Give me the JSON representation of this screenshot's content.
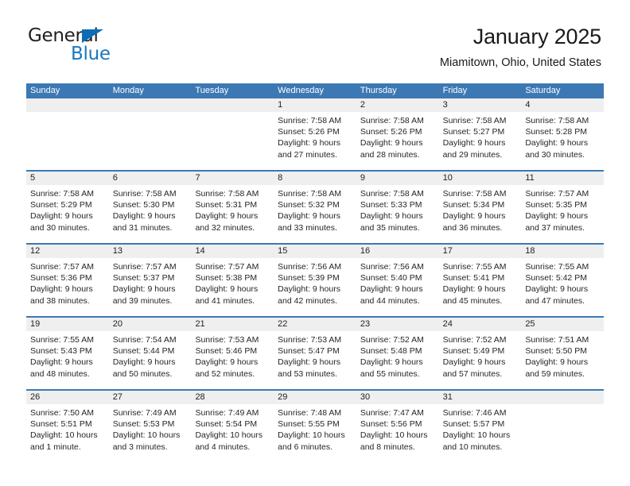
{
  "brand": {
    "name_top": "General",
    "name_bottom": "Blue",
    "triangle_color": "#0b6cb7",
    "blue_text_color": "#1878be"
  },
  "header": {
    "title": "January 2025",
    "subtitle": "Miamitown, Ohio, United States"
  },
  "colors": {
    "header_blue": "#3c78b4",
    "daynum_band": "#efefef",
    "text": "#262626"
  },
  "weekdays": [
    "Sunday",
    "Monday",
    "Tuesday",
    "Wednesday",
    "Thursday",
    "Friday",
    "Saturday"
  ],
  "weeks": [
    [
      {
        "day": "",
        "lines": []
      },
      {
        "day": "",
        "lines": []
      },
      {
        "day": "",
        "lines": []
      },
      {
        "day": "1",
        "lines": [
          "Sunrise: 7:58 AM",
          "Sunset: 5:26 PM",
          "Daylight: 9 hours",
          "and 27 minutes."
        ]
      },
      {
        "day": "2",
        "lines": [
          "Sunrise: 7:58 AM",
          "Sunset: 5:26 PM",
          "Daylight: 9 hours",
          "and 28 minutes."
        ]
      },
      {
        "day": "3",
        "lines": [
          "Sunrise: 7:58 AM",
          "Sunset: 5:27 PM",
          "Daylight: 9 hours",
          "and 29 minutes."
        ]
      },
      {
        "day": "4",
        "lines": [
          "Sunrise: 7:58 AM",
          "Sunset: 5:28 PM",
          "Daylight: 9 hours",
          "and 30 minutes."
        ]
      }
    ],
    [
      {
        "day": "5",
        "lines": [
          "Sunrise: 7:58 AM",
          "Sunset: 5:29 PM",
          "Daylight: 9 hours",
          "and 30 minutes."
        ]
      },
      {
        "day": "6",
        "lines": [
          "Sunrise: 7:58 AM",
          "Sunset: 5:30 PM",
          "Daylight: 9 hours",
          "and 31 minutes."
        ]
      },
      {
        "day": "7",
        "lines": [
          "Sunrise: 7:58 AM",
          "Sunset: 5:31 PM",
          "Daylight: 9 hours",
          "and 32 minutes."
        ]
      },
      {
        "day": "8",
        "lines": [
          "Sunrise: 7:58 AM",
          "Sunset: 5:32 PM",
          "Daylight: 9 hours",
          "and 33 minutes."
        ]
      },
      {
        "day": "9",
        "lines": [
          "Sunrise: 7:58 AM",
          "Sunset: 5:33 PM",
          "Daylight: 9 hours",
          "and 35 minutes."
        ]
      },
      {
        "day": "10",
        "lines": [
          "Sunrise: 7:58 AM",
          "Sunset: 5:34 PM",
          "Daylight: 9 hours",
          "and 36 minutes."
        ]
      },
      {
        "day": "11",
        "lines": [
          "Sunrise: 7:57 AM",
          "Sunset: 5:35 PM",
          "Daylight: 9 hours",
          "and 37 minutes."
        ]
      }
    ],
    [
      {
        "day": "12",
        "lines": [
          "Sunrise: 7:57 AM",
          "Sunset: 5:36 PM",
          "Daylight: 9 hours",
          "and 38 minutes."
        ]
      },
      {
        "day": "13",
        "lines": [
          "Sunrise: 7:57 AM",
          "Sunset: 5:37 PM",
          "Daylight: 9 hours",
          "and 39 minutes."
        ]
      },
      {
        "day": "14",
        "lines": [
          "Sunrise: 7:57 AM",
          "Sunset: 5:38 PM",
          "Daylight: 9 hours",
          "and 41 minutes."
        ]
      },
      {
        "day": "15",
        "lines": [
          "Sunrise: 7:56 AM",
          "Sunset: 5:39 PM",
          "Daylight: 9 hours",
          "and 42 minutes."
        ]
      },
      {
        "day": "16",
        "lines": [
          "Sunrise: 7:56 AM",
          "Sunset: 5:40 PM",
          "Daylight: 9 hours",
          "and 44 minutes."
        ]
      },
      {
        "day": "17",
        "lines": [
          "Sunrise: 7:55 AM",
          "Sunset: 5:41 PM",
          "Daylight: 9 hours",
          "and 45 minutes."
        ]
      },
      {
        "day": "18",
        "lines": [
          "Sunrise: 7:55 AM",
          "Sunset: 5:42 PM",
          "Daylight: 9 hours",
          "and 47 minutes."
        ]
      }
    ],
    [
      {
        "day": "19",
        "lines": [
          "Sunrise: 7:55 AM",
          "Sunset: 5:43 PM",
          "Daylight: 9 hours",
          "and 48 minutes."
        ]
      },
      {
        "day": "20",
        "lines": [
          "Sunrise: 7:54 AM",
          "Sunset: 5:44 PM",
          "Daylight: 9 hours",
          "and 50 minutes."
        ]
      },
      {
        "day": "21",
        "lines": [
          "Sunrise: 7:53 AM",
          "Sunset: 5:46 PM",
          "Daylight: 9 hours",
          "and 52 minutes."
        ]
      },
      {
        "day": "22",
        "lines": [
          "Sunrise: 7:53 AM",
          "Sunset: 5:47 PM",
          "Daylight: 9 hours",
          "and 53 minutes."
        ]
      },
      {
        "day": "23",
        "lines": [
          "Sunrise: 7:52 AM",
          "Sunset: 5:48 PM",
          "Daylight: 9 hours",
          "and 55 minutes."
        ]
      },
      {
        "day": "24",
        "lines": [
          "Sunrise: 7:52 AM",
          "Sunset: 5:49 PM",
          "Daylight: 9 hours",
          "and 57 minutes."
        ]
      },
      {
        "day": "25",
        "lines": [
          "Sunrise: 7:51 AM",
          "Sunset: 5:50 PM",
          "Daylight: 9 hours",
          "and 59 minutes."
        ]
      }
    ],
    [
      {
        "day": "26",
        "lines": [
          "Sunrise: 7:50 AM",
          "Sunset: 5:51 PM",
          "Daylight: 10 hours",
          "and 1 minute."
        ]
      },
      {
        "day": "27",
        "lines": [
          "Sunrise: 7:49 AM",
          "Sunset: 5:53 PM",
          "Daylight: 10 hours",
          "and 3 minutes."
        ]
      },
      {
        "day": "28",
        "lines": [
          "Sunrise: 7:49 AM",
          "Sunset: 5:54 PM",
          "Daylight: 10 hours",
          "and 4 minutes."
        ]
      },
      {
        "day": "29",
        "lines": [
          "Sunrise: 7:48 AM",
          "Sunset: 5:55 PM",
          "Daylight: 10 hours",
          "and 6 minutes."
        ]
      },
      {
        "day": "30",
        "lines": [
          "Sunrise: 7:47 AM",
          "Sunset: 5:56 PM",
          "Daylight: 10 hours",
          "and 8 minutes."
        ]
      },
      {
        "day": "31",
        "lines": [
          "Sunrise: 7:46 AM",
          "Sunset: 5:57 PM",
          "Daylight: 10 hours",
          "and 10 minutes."
        ]
      },
      {
        "day": "",
        "lines": []
      }
    ]
  ]
}
